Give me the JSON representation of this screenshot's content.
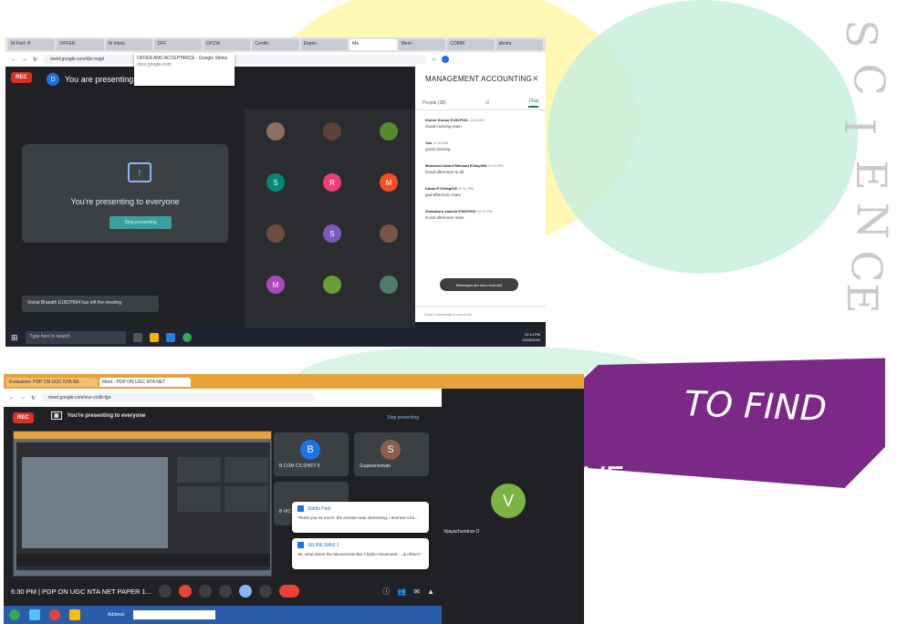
{
  "background": {
    "watermark_letters": [
      "S",
      "C",
      "I",
      "E",
      "N",
      "C",
      "E"
    ],
    "ribbon_text": "TO FIND",
    "ribbon_text_2": "VE",
    "colors": {
      "ribbon": "#7a2a86",
      "blob_yellow": "#fff7a8",
      "blob_green": "#c8f0dd"
    }
  },
  "screen1": {
    "tabs": [
      "M Fwd: H",
      "OFFER",
      "M Inbox",
      "OFF",
      "OFCW",
      "Certific",
      "Expen",
      "Me",
      "Meet -",
      "COMM",
      "abstra"
    ],
    "url": "meet.google.com/dzr-mqpl",
    "tooltip": {
      "title": "OFFER AND ACCEPTANCE - Google Slides",
      "domain": "docs.google.com"
    },
    "rec_label": "REC",
    "presenter_avatar": "D",
    "presenter_text": "You are presenting",
    "present_card": {
      "text": "You're presenting to everyone",
      "button": "Stop presenting"
    },
    "left_toast": "Vishal Bharath E18CP064 has left the meeting",
    "grid_tiles": [
      {
        "label": "",
        "color": "#8d6e63"
      },
      {
        "label": "",
        "color": "#5d4037"
      },
      {
        "label": "",
        "color": "#558b2f"
      },
      {
        "label": "S",
        "color": "#00897b"
      },
      {
        "label": "R",
        "color": "#ec407a"
      },
      {
        "label": "M",
        "color": "#f4511e"
      },
      {
        "label": "",
        "color": "#6d4c41"
      },
      {
        "label": "S",
        "color": "#7e57c2"
      },
      {
        "label": "",
        "color": "#795548"
      },
      {
        "label": "M",
        "color": "#ab47bc"
      },
      {
        "label": "",
        "color": "#689f38"
      },
      {
        "label": "",
        "color": "#4e7d6a"
      }
    ],
    "panel": {
      "title": "MANAGEMENT ACCOUNTING",
      "people_tab": "People (38)",
      "chat_tab": "Chat",
      "messages": [
        {
          "name": "Kishor Kumar E18CP061",
          "time": "11:54 AM",
          "text": "Good morning mam"
        },
        {
          "name": "You",
          "time": "11:54 AM",
          "text": "good morning"
        },
        {
          "name": "Mohamed Abdul Rahman E18cp059",
          "time": "12:00 PM",
          "text": "Good afternoon to all"
        },
        {
          "name": "Karan.R E18cp033",
          "time": "12:11 PM",
          "text": "gud afternoon mam"
        },
        {
          "name": "Jhanakuru vamshi E18CP010",
          "time": "12:12 PM",
          "text": "Good afternoon mam"
        }
      ],
      "permission_text": "Messages are also recorded",
      "send_placeholder": "Send a message to everyone"
    },
    "taskbar": {
      "search_placeholder": "Type here to search",
      "time": "12:14 PM",
      "date": "10/09/2020"
    }
  },
  "screen2": {
    "tabs": [
      "Evaluation: PDP ON UGC NTA NE",
      "Meet - PDP ON UGC NTA NET"
    ],
    "url": "meet.google.com/vuz-zcdb-fgo",
    "rec_label": "REC",
    "present_text": "You're presenting to everyone",
    "stop_text": "Stop presenting",
    "tiles": [
      {
        "avatar": "B",
        "name": "B.COM CS SHIFT II",
        "color": "#1a73e8"
      },
      {
        "avatar": "S",
        "name": "Sugavaneswari",
        "color": "#8d5c4a"
      }
    ],
    "partial_tile_name": "B VIC",
    "toasts": [
      {
        "name": "Siddhi Patil",
        "text": "Thank you so much. the session was interesting, i learned a lot..."
      },
      {
        "name": "JELINE RANI J",
        "text": "Sir, what about the Movements like Chipko movement.....& others?"
      }
    ],
    "side_tile": {
      "avatar": "V",
      "name": "Vijayachandran D"
    },
    "controls": {
      "meeting": "6:30 PM  |  PDP ON UGC NTA NET PAPER 1..."
    },
    "taskbar": {
      "address_label": "Address"
    }
  }
}
